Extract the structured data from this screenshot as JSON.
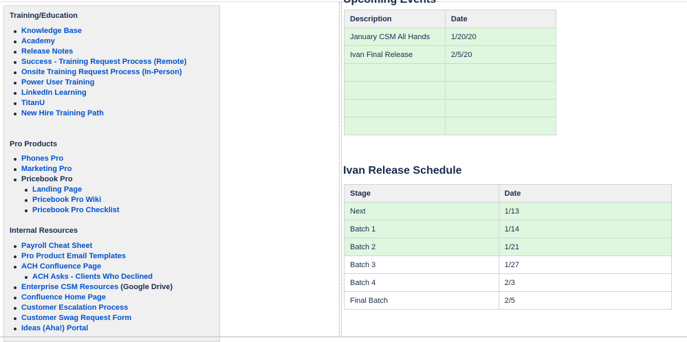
{
  "training": {
    "title": "Training/Education",
    "items": [
      {
        "label": "Knowledge Base"
      },
      {
        "label": "Academy"
      },
      {
        "label": "Release Notes"
      },
      {
        "label": "Success - Training Request Process (Remote)"
      },
      {
        "label": "Onsite Training Request Process (In-Person)"
      },
      {
        "label": "Power User Training"
      },
      {
        "label": "LinkedIn Learning"
      },
      {
        "label": "TitanU"
      },
      {
        "label": "New Hire Training Path"
      }
    ]
  },
  "pro_products": {
    "title": "Pro Products",
    "items": [
      {
        "label": "Phones Pro"
      },
      {
        "label": "Marketing Pro"
      },
      {
        "label": "Pricebook Pro"
      },
      {
        "label": "Landing Page"
      },
      {
        "label": "Pricebook Pro Wiki"
      },
      {
        "label": "Pricebook Pro Checklist"
      }
    ]
  },
  "internal": {
    "title": "Internal Resources",
    "items": [
      {
        "label": "Payroll Cheat Sheet"
      },
      {
        "label": "Pro Product Email Templates"
      },
      {
        "label": "ACH Confluence Page"
      },
      {
        "label": "ACH Asks - Clients Who Declined"
      },
      {
        "label": "Enterprise CSM Resources",
        "suffix": " (Google Drive)"
      },
      {
        "label": "Confluence Home Page"
      },
      {
        "label": "Customer Escalation Process"
      },
      {
        "label": "Customer Swag Request Form"
      },
      {
        "label": "Ideas (Aha!) Portal"
      }
    ]
  },
  "events_table": {
    "heading_partial": "Upcoming Events",
    "headers": [
      "Description",
      "Date"
    ],
    "rows": [
      [
        "January CSM All Hands",
        "1/20/20"
      ],
      [
        "Ivan Final Release",
        "2/5/20"
      ],
      [
        "",
        ""
      ],
      [
        "",
        ""
      ],
      [
        "",
        ""
      ],
      [
        "",
        ""
      ]
    ]
  },
  "release": {
    "title": "Ivan Release Schedule",
    "headers": [
      "Stage",
      "Date"
    ],
    "rows": [
      [
        "Next",
        "1/13"
      ],
      [
        "Batch 1",
        "1/14"
      ],
      [
        "Batch 2",
        "1/21"
      ],
      [
        "Batch 3",
        "1/27"
      ],
      [
        "Batch 4",
        "2/3"
      ],
      [
        "Final Batch",
        "2/5"
      ]
    ]
  }
}
